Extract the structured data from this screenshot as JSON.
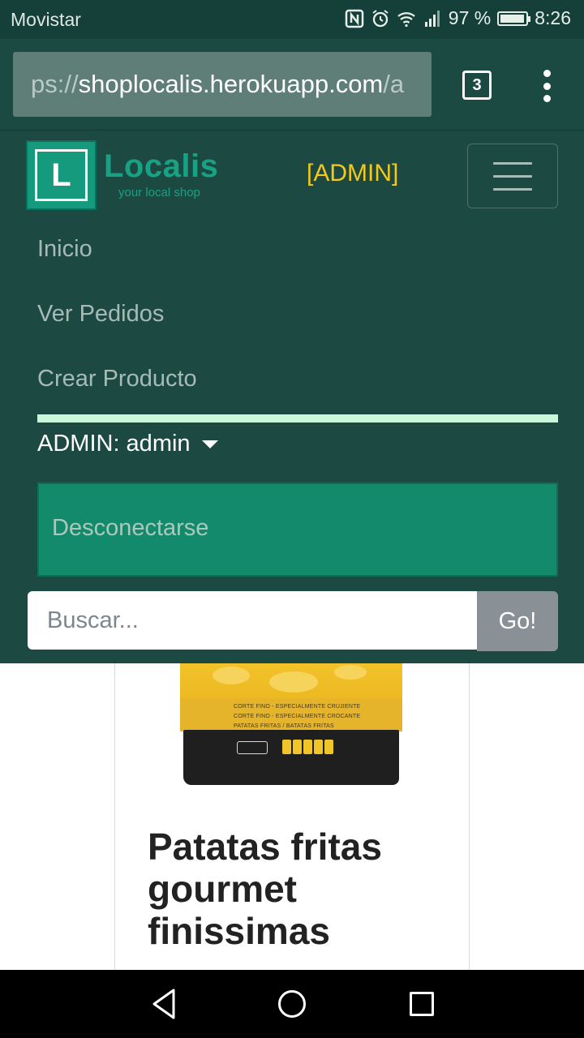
{
  "status_bar": {
    "carrier": "Movistar",
    "battery_text": "97 %",
    "battery_level": 0.97,
    "time": "8:26",
    "icons": [
      "nfc-icon",
      "alarm-icon",
      "wifi-icon",
      "signal-icon",
      "battery-icon"
    ]
  },
  "browser": {
    "url_scheme": "ps://",
    "url_host": "shoplocalis.herokuapp.com",
    "url_rest": "/a",
    "tab_count": "3"
  },
  "navbar": {
    "logo_letter": "L",
    "logo_name": "Localis",
    "logo_tagline": "your local shop",
    "admin_badge": "[ADMIN]",
    "links": [
      "Inicio",
      "Ver Pedidos",
      "Crear Producto"
    ],
    "user_menu_label": "ADMIN: admin",
    "logout_label": "Desconectarse",
    "search_placeholder": "Buscar...",
    "search_button": "Go!"
  },
  "product": {
    "title": "Patatas fritas gourmet finissimas",
    "package_lines": [
      "CORTE FINO - ESPECIALMENTE CRUJIENTE",
      "CORTE FINO - ESPECIALMENTE CROCANTE",
      "PATATAS FRITAS / BATATAS FRITAS"
    ]
  },
  "colors": {
    "status_bar": "#15403a",
    "navbar": "#1c4a43",
    "brand_green": "#17a383",
    "admin_yellow": "#f2c81c",
    "logout_bg": "#148a6d"
  }
}
